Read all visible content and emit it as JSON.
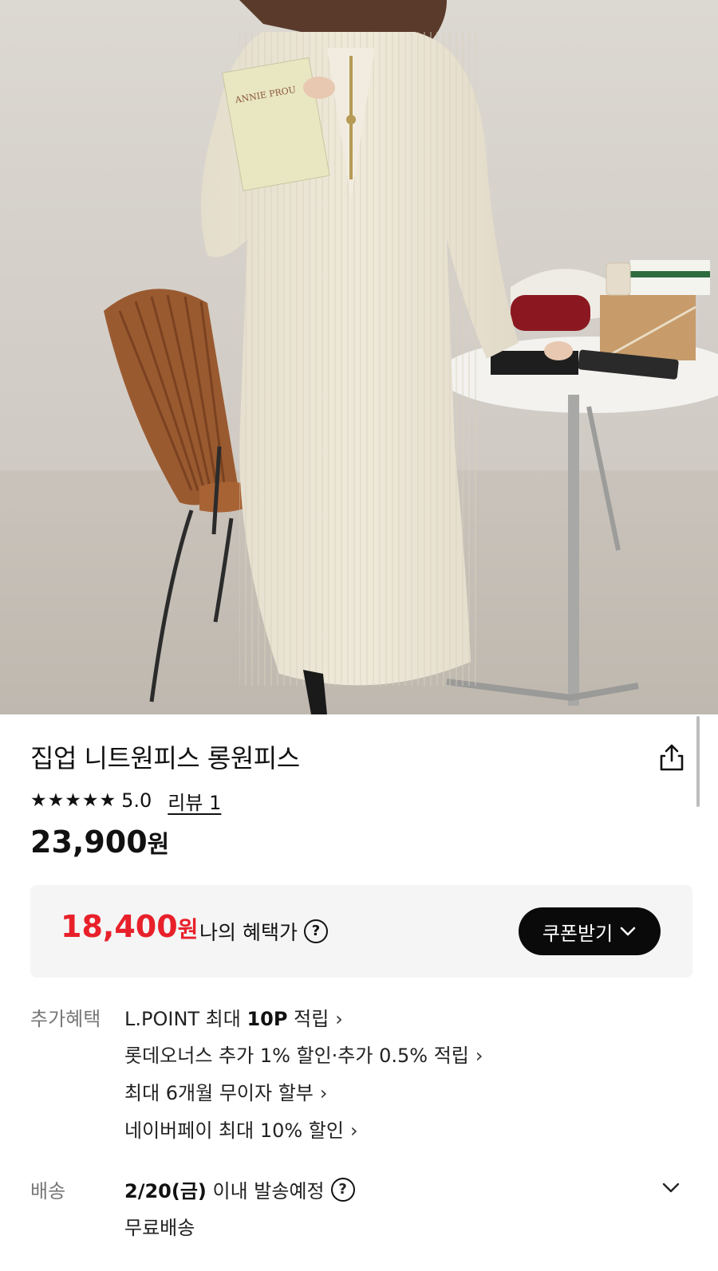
{
  "product": {
    "title": "집업 니트원피스 롱원피스",
    "stars": "★★★★★",
    "rating": "5.0",
    "reviews_label": "리뷰 1",
    "price": "23,900",
    "price_unit": "원"
  },
  "benefit": {
    "sale_price": "18,400",
    "sale_unit": "원",
    "label": "나의 혜택가",
    "coupon_button": "쿠폰받기"
  },
  "extra_benefits": {
    "label": "추가혜택",
    "items": [
      {
        "prefix": "L.POINT 최대 ",
        "bold": "10P",
        "suffix": " 적립"
      },
      {
        "prefix": "롯데오너스 추가 1% 할인·추가 0.5% 적립",
        "bold": "",
        "suffix": ""
      },
      {
        "prefix": "최대 6개월 무이자 할부",
        "bold": "",
        "suffix": ""
      },
      {
        "prefix": "네이버페이 최대 10% 할인",
        "bold": "",
        "suffix": ""
      }
    ]
  },
  "shipping": {
    "label": "배송",
    "date": "2/20(금)",
    "date_suffix": " 이내 발송예정",
    "fee": "무료배송"
  },
  "icons": {
    "share": "share-icon",
    "help": "question-circle-icon",
    "chevron": "chevron-down-icon",
    "arrow": "chevron-right-icon"
  },
  "colors": {
    "sale_red": "#e8202a",
    "button_black": "#0a0a0a",
    "box_gray": "#f5f5f5"
  }
}
